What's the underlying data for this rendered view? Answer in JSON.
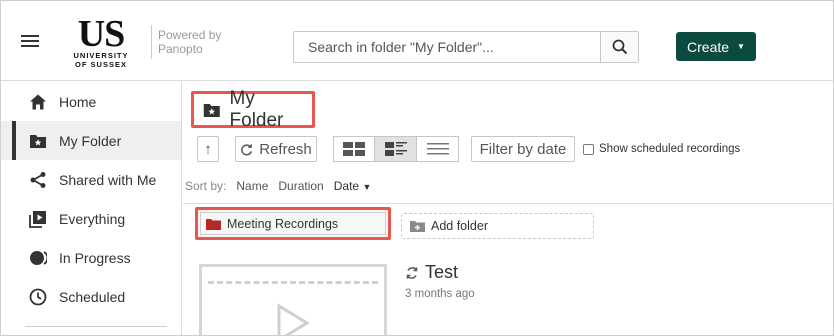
{
  "header": {
    "logo_main": "US",
    "logo_sub1": "UNIVERSITY",
    "logo_sub2": "OF SUSSEX",
    "powered_line1": "Powered by",
    "powered_line2": "Panopto",
    "search_placeholder": "Search in folder \"My Folder\"...",
    "create_label": "Create",
    "create_color": "#0b4a3f",
    "icons": {
      "menu": "hamburger-icon",
      "search": "search-icon",
      "create_caret": "caret-down-icon"
    }
  },
  "sidebar": {
    "items": [
      {
        "label": "Home",
        "icon": "home-icon",
        "active": false
      },
      {
        "label": "My Folder",
        "icon": "folder-star-icon",
        "active": true
      },
      {
        "label": "Shared with Me",
        "icon": "share-icon",
        "active": false
      },
      {
        "label": "Everything",
        "icon": "play-stack-icon",
        "active": false
      },
      {
        "label": "In Progress",
        "icon": "in-progress-icon",
        "active": false
      },
      {
        "label": "Scheduled",
        "icon": "clock-icon",
        "active": false
      }
    ]
  },
  "main": {
    "folder_title": "My Folder",
    "toolbar": {
      "up_glyph": "↑",
      "refresh_label": "Refresh",
      "view_modes": [
        "thumbnail",
        "detail",
        "list"
      ],
      "selected_view": "detail",
      "filter_label": "Filter by date",
      "show_scheduled_label": "Show scheduled recordings",
      "show_scheduled_checked": false
    },
    "sort": {
      "prefix": "Sort by:",
      "options": [
        "Name",
        "Duration",
        "Date"
      ],
      "active": "Date",
      "direction_glyph": "▼"
    },
    "subfolders": [
      {
        "label": "Meeting Recordings",
        "icon": "folder-icon",
        "icon_color": "#b3292a"
      }
    ],
    "add_folder_label": "Add folder",
    "sessions": [
      {
        "title": "Test",
        "meta": "3 months ago",
        "status_icon": "processing-icon"
      }
    ],
    "highlight_color": "#e8574d"
  }
}
